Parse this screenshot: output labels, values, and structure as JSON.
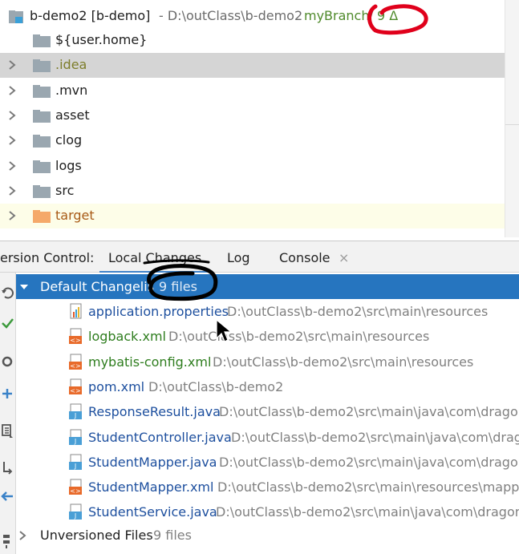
{
  "project": {
    "root": {
      "name": "b-demo2 [b-demo]",
      "path": "- D:\\outClass\\b-demo2",
      "branch": "myBranch",
      "separator": "/",
      "changes": "9 Δ"
    },
    "items": [
      {
        "label": "${user.home}",
        "expandable": false
      },
      {
        "label": ".idea",
        "expandable": true,
        "selected": true
      },
      {
        "label": ".mvn",
        "expandable": true
      },
      {
        "label": "asset",
        "expandable": true
      },
      {
        "label": "clog",
        "expandable": true
      },
      {
        "label": "logs",
        "expandable": true
      },
      {
        "label": "src",
        "expandable": true
      },
      {
        "label": "target",
        "expandable": true,
        "excluded": true
      }
    ]
  },
  "vc": {
    "title": "ersion Control:",
    "tabs": [
      {
        "label": "Local Changes",
        "active": true
      },
      {
        "label": "Log"
      },
      {
        "label": "Console",
        "closable": true
      }
    ],
    "close_glyph": "×"
  },
  "changes": {
    "changelist": {
      "name": "Default Changelis",
      "count": "9 files"
    },
    "files": [
      {
        "name": "application.properties",
        "path": "D:\\outClass\\b-demo2\\src\\main\\resources",
        "status": "modified",
        "icon": "properties-file-icon"
      },
      {
        "name": "logback.xml",
        "path": "D:\\outClass\\b-demo2\\src\\main\\resources",
        "status": "added",
        "icon": "xml-file-icon"
      },
      {
        "name": "mybatis-config.xml",
        "path": "D:\\outClass\\b-demo2\\src\\main\\resources",
        "status": "added",
        "icon": "xml-file-icon"
      },
      {
        "name": "pom.xml",
        "path": "D:\\outClass\\b-demo2",
        "status": "modified",
        "icon": "xml-file-icon"
      },
      {
        "name": "ResponseResult.java",
        "path": "D:\\outClass\\b-demo2\\src\\main\\java\\com\\dragon",
        "status": "modified",
        "icon": "java-file-icon"
      },
      {
        "name": "StudentController.java",
        "path": "D:\\outClass\\b-demo2\\src\\main\\java\\com\\drag",
        "status": "modified",
        "icon": "java-file-icon"
      },
      {
        "name": "StudentMapper.java",
        "path": "D:\\outClass\\b-demo2\\src\\main\\java\\com\\dragor",
        "status": "modified",
        "icon": "java-file-icon"
      },
      {
        "name": "StudentMapper.xml",
        "path": "D:\\outClass\\b-demo2\\src\\main\\resources\\mappe",
        "status": "modified",
        "icon": "xml-file-icon"
      },
      {
        "name": "StudentService.java",
        "path": "D:\\outClass\\b-demo2\\src\\main\\java\\com\\dragon7",
        "status": "modified",
        "icon": "java-file-icon"
      }
    ],
    "unversioned": {
      "name": "Unversioned Files",
      "count": "9 files"
    }
  },
  "colors": {
    "selection_blue": "#2675bf",
    "modified_blue": "#1d4f9e",
    "added_green": "#2e7d1e",
    "branch_green": "#4f8a2b",
    "annotation_red": "#e0001b",
    "annotation_black": "#000000"
  }
}
